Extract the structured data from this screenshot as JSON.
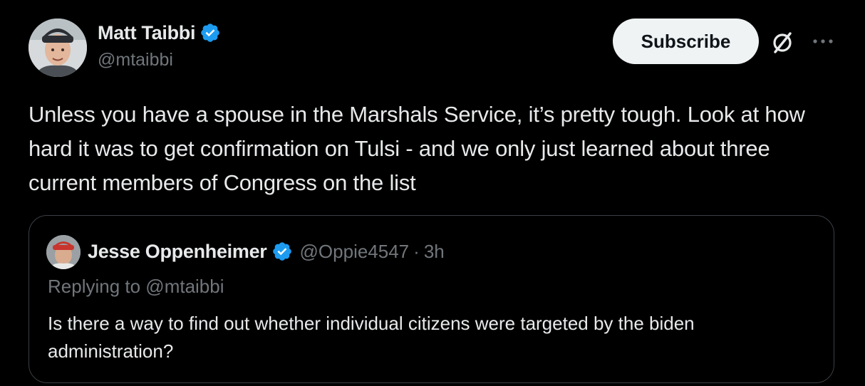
{
  "author": {
    "display_name": "Matt Taibbi",
    "handle": "@mtaibbi",
    "verified": true
  },
  "actions": {
    "subscribe_label": "Subscribe",
    "grok_icon": "grok-icon",
    "more_icon": "more-options-icon"
  },
  "tweet": {
    "text": "Unless you have a spouse in the Marshals Service, it’s pretty tough. Look at how hard it was to get confirmation on Tulsi - and we only just learned about three current members of Congress on the list"
  },
  "quoted_tweet": {
    "display_name": "Jesse Oppenheimer",
    "handle": "@Oppie4547",
    "separator": "·",
    "time": "3h",
    "replying_to": "Replying to @mtaibbi",
    "text": "Is there a way to find out whether individual citizens were targeted by the biden administration?"
  },
  "colors": {
    "background": "#000000",
    "primary_text": "#e7e9ea",
    "secondary_text": "#71767b",
    "verified_badge": "#1d9bf0",
    "border": "#3a3f44",
    "subscribe_bg": "#eff3f4"
  }
}
